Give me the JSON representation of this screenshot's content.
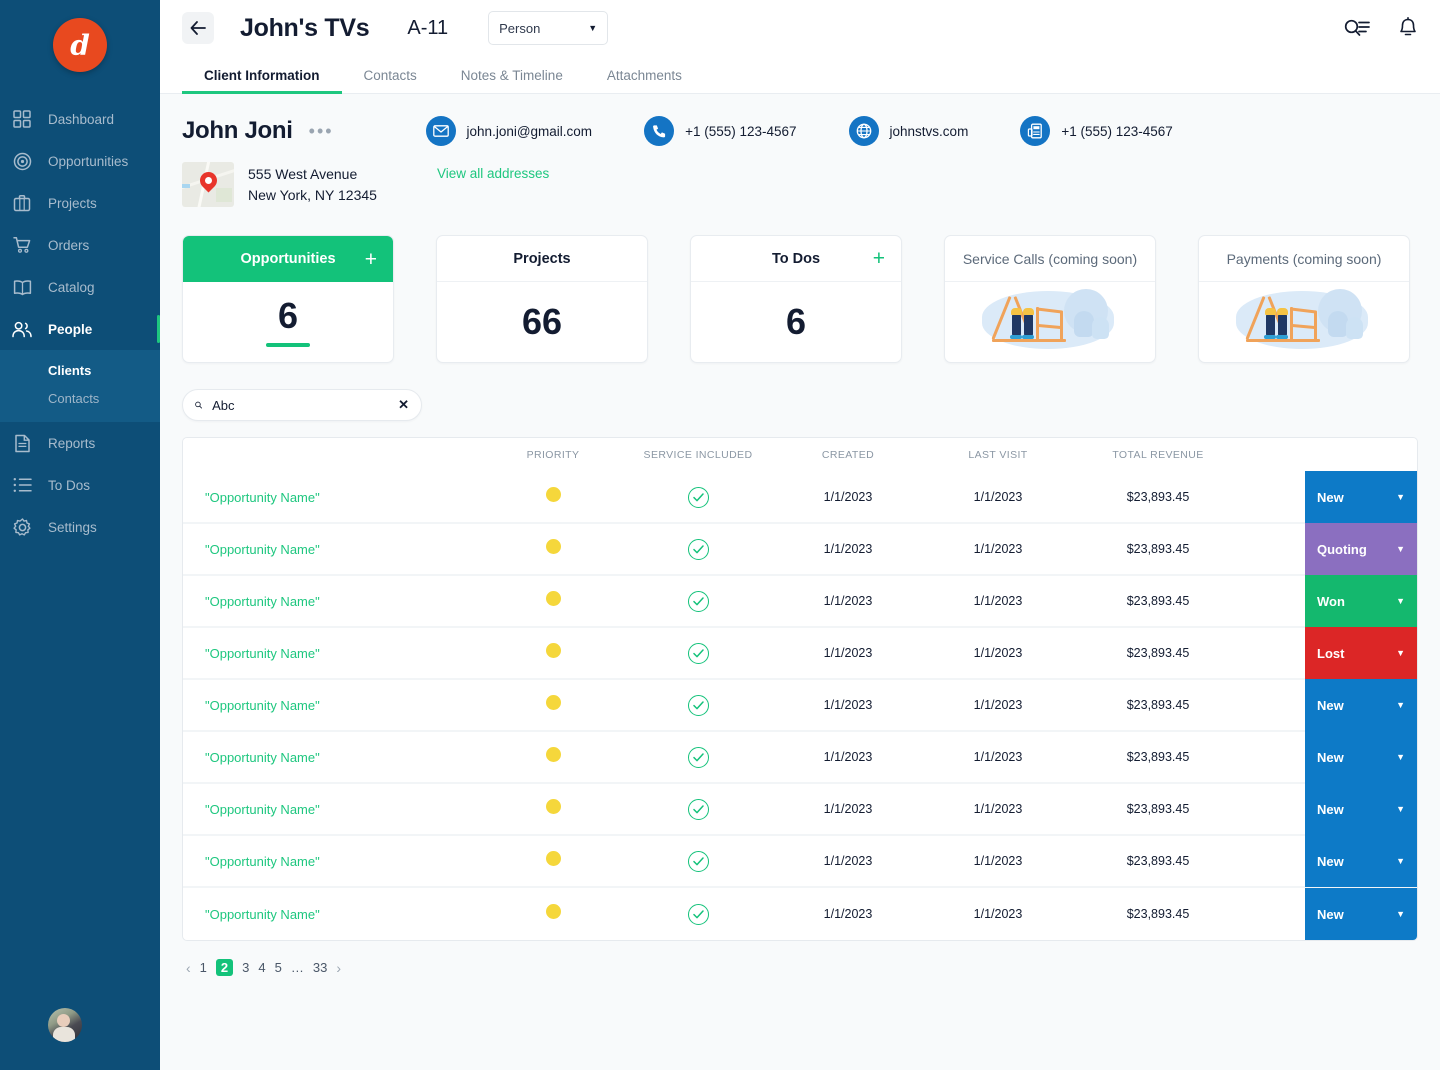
{
  "brand": {
    "logo_letter": "d",
    "logo_color": "#e8491f",
    "sidebar_color": "#0d4e77",
    "accent_green": "#13c27a"
  },
  "sidebar": {
    "items": [
      {
        "label": "Dashboard",
        "icon": "grid-icon",
        "active": false
      },
      {
        "label": "Opportunities",
        "icon": "target-icon",
        "active": false
      },
      {
        "label": "Projects",
        "icon": "briefcase-icon",
        "active": false
      },
      {
        "label": "Orders",
        "icon": "cart-icon",
        "active": false
      },
      {
        "label": "Catalog",
        "icon": "book-icon",
        "active": false
      },
      {
        "label": "People",
        "icon": "people-icon",
        "active": true
      },
      {
        "label": "Reports",
        "icon": "document-icon",
        "active": false
      },
      {
        "label": "To Dos",
        "icon": "list-icon",
        "active": false
      },
      {
        "label": "Settings",
        "icon": "gear-icon",
        "active": false
      }
    ],
    "submenu": [
      {
        "label": "Clients",
        "active": true
      },
      {
        "label": "Contacts",
        "active": false
      }
    ]
  },
  "topbar": {
    "back_icon": "arrow-left-icon",
    "title": "John's TVs",
    "code": "A-11",
    "select_value": "Person",
    "search_icon": "search-list-icon",
    "bell_icon": "bell-icon"
  },
  "tabs": [
    {
      "label": "Client Information",
      "active": true
    },
    {
      "label": "Contacts",
      "active": false
    },
    {
      "label": "Notes & Timeline",
      "active": false
    },
    {
      "label": "Attachments",
      "active": false
    }
  ],
  "client": {
    "name": "John Joni",
    "more_label": "•••",
    "contacts": [
      {
        "icon": "envelope-icon",
        "value": "john.joni@gmail.com"
      },
      {
        "icon": "phone-icon",
        "value": "+1 (555) 123-4567"
      },
      {
        "icon": "globe-icon",
        "value": "johnstvs.com"
      },
      {
        "icon": "fax-icon",
        "value": "+1 (555) 123-4567"
      }
    ],
    "address_line1": "555 West Avenue",
    "address_line2": "New York, NY 12345",
    "view_all_label": "View all addresses"
  },
  "cards": [
    {
      "title": "Opportunities",
      "value": "6",
      "plus": "+",
      "style": "primary",
      "underline": true
    },
    {
      "title": "Projects",
      "value": "66",
      "plus": "",
      "style": "plain",
      "underline": false
    },
    {
      "title": "To Dos",
      "value": "6",
      "plus": "+",
      "style": "plain",
      "underline": false
    },
    {
      "title": "Service Calls (coming soon)",
      "value": "",
      "plus": "",
      "style": "soon",
      "underline": false
    },
    {
      "title": "Payments (coming soon)",
      "value": "",
      "plus": "",
      "style": "soon",
      "underline": false
    }
  ],
  "search": {
    "value": "Abc",
    "placeholder": "Search",
    "icon": "search-icon",
    "clear": "✕"
  },
  "table": {
    "columns": [
      "",
      "PRIORITY",
      "SERVICE INCLUDED",
      "CREATED",
      "LAST VISIT",
      "TOTAL REVENUE",
      ""
    ],
    "rows": [
      {
        "name": "\"Opportunity Name\"",
        "priority": "yellow",
        "service": true,
        "created": "1/1/2023",
        "last_visit": "1/1/2023",
        "revenue": "$23,893.45",
        "status": "New",
        "status_color": "#0d7ac7"
      },
      {
        "name": "\"Opportunity Name\"",
        "priority": "yellow",
        "service": true,
        "created": "1/1/2023",
        "last_visit": "1/1/2023",
        "revenue": "$23,893.45",
        "status": "Quoting",
        "status_color": "#8b6fc0"
      },
      {
        "name": "\"Opportunity Name\"",
        "priority": "yellow",
        "service": true,
        "created": "1/1/2023",
        "last_visit": "1/1/2023",
        "revenue": "$23,893.45",
        "status": "Won",
        "status_color": "#14b86e"
      },
      {
        "name": "\"Opportunity Name\"",
        "priority": "yellow",
        "service": true,
        "created": "1/1/2023",
        "last_visit": "1/1/2023",
        "revenue": "$23,893.45",
        "status": "Lost",
        "status_color": "#dc2626"
      },
      {
        "name": "\"Opportunity Name\"",
        "priority": "yellow",
        "service": true,
        "created": "1/1/2023",
        "last_visit": "1/1/2023",
        "revenue": "$23,893.45",
        "status": "New",
        "status_color": "#0d7ac7"
      },
      {
        "name": "\"Opportunity Name\"",
        "priority": "yellow",
        "service": true,
        "created": "1/1/2023",
        "last_visit": "1/1/2023",
        "revenue": "$23,893.45",
        "status": "New",
        "status_color": "#0d7ac7"
      },
      {
        "name": "\"Opportunity Name\"",
        "priority": "yellow",
        "service": true,
        "created": "1/1/2023",
        "last_visit": "1/1/2023",
        "revenue": "$23,893.45",
        "status": "New",
        "status_color": "#0d7ac7"
      },
      {
        "name": "\"Opportunity Name\"",
        "priority": "yellow",
        "service": true,
        "created": "1/1/2023",
        "last_visit": "1/1/2023",
        "revenue": "$23,893.45",
        "status": "New",
        "status_color": "#0d7ac7"
      },
      {
        "name": "\"Opportunity Name\"",
        "priority": "yellow",
        "service": true,
        "created": "1/1/2023",
        "last_visit": "1/1/2023",
        "revenue": "$23,893.45",
        "status": "New",
        "status_color": "#0d7ac7"
      }
    ]
  },
  "pagination": {
    "prev": "‹",
    "next": "›",
    "pages": [
      "1",
      "2",
      "3",
      "4",
      "5",
      "…",
      "33"
    ],
    "active": "2"
  }
}
